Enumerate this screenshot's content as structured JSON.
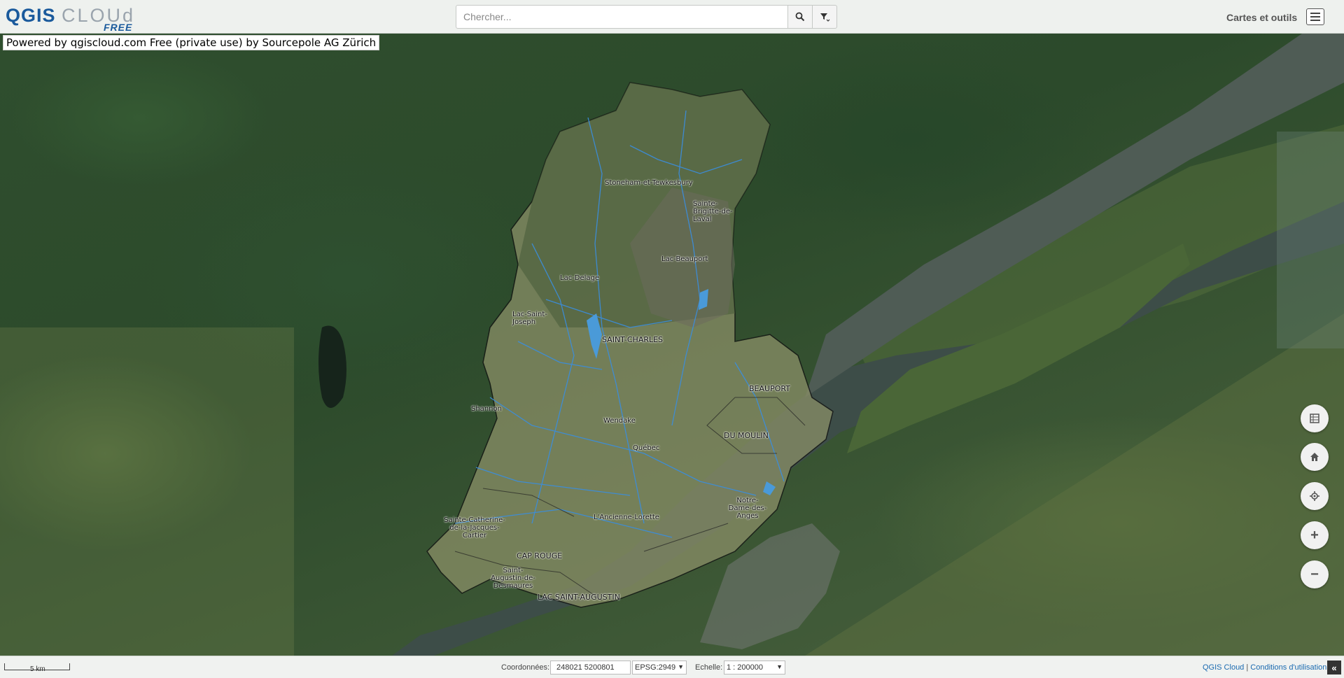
{
  "logo": {
    "main_a": "QGIS",
    "main_b": "CLOUd",
    "sub": "FREE"
  },
  "search": {
    "placeholder": "Chercher..."
  },
  "header": {
    "maps_tools_label": "Cartes et outils"
  },
  "powered_by": "Powered by qgiscloud.com Free (private use) by Sourcepole AG Zürich",
  "map_labels": {
    "stoneham": "Stoneham-et-Tewkesbury",
    "sainte_brigitte": "Sainte-Brigitte-de-Laval",
    "lac_beauport": "Lac-Beauport",
    "lac_delage": "Lac-Delage",
    "lac_st_joseph": "Lac-Saint-Joseph",
    "saint_charles": "SAINT-CHARLES",
    "beauport": "BEAUPORT",
    "shannon": "Shannon",
    "wendake": "Wendake",
    "du_moulin": "DU MOULIN",
    "quebec": "Québec",
    "notre_dame": "Notre-Dame-des-Anges",
    "ste_catherine": "Sainte-Catherine-de-la-Jacques-Cartier",
    "ancienne_lorette": "L'Ancienne-Lorette",
    "cap_rouge": "CAP ROUGE",
    "st_augustin": "Saint-Augustin-de-Desmaures",
    "lac_st_augustin": "LAC SAINT-AUGUSTIN"
  },
  "controls": {
    "table_icon": "table-icon",
    "home_icon": "home-icon",
    "locate_icon": "locate-icon",
    "zoom_in": "+",
    "zoom_out": "−"
  },
  "bottom": {
    "scalebar_label": "5 km",
    "coord_label": "Coordonnées:",
    "coord_value": "248021 5200801",
    "epsg": "EPSG:2949",
    "scale_label": "Echelle:",
    "scale_value": "1 : 200000",
    "link_qgis": "QGIS Cloud",
    "link_separator": "|",
    "link_terms": "Conditions d'utilisation",
    "collapse": "«"
  }
}
